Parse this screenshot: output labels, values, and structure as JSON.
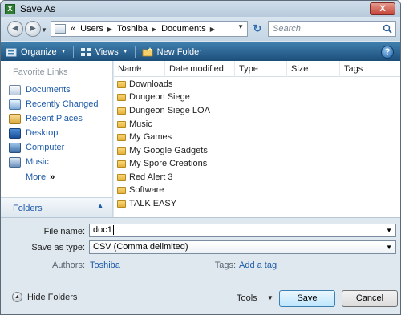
{
  "window": {
    "title": "Save As",
    "close_label": "X"
  },
  "address": {
    "crumbs": [
      "Users",
      "Toshiba",
      "Documents"
    ],
    "prefix": "«"
  },
  "search": {
    "placeholder": "Search"
  },
  "toolbar": {
    "organize": "Organize",
    "views": "Views",
    "new_folder": "New Folder",
    "help": "?"
  },
  "sidebar": {
    "heading": "Favorite Links",
    "items": [
      {
        "label": "Documents",
        "icon": "documents-icon"
      },
      {
        "label": "Recently Changed",
        "icon": "recently-changed-icon"
      },
      {
        "label": "Recent Places",
        "icon": "recent-places-icon"
      },
      {
        "label": "Desktop",
        "icon": "desktop-icon"
      },
      {
        "label": "Computer",
        "icon": "computer-icon"
      },
      {
        "label": "Music",
        "icon": "music-icon"
      }
    ],
    "more": "More",
    "folders": "Folders"
  },
  "columns": [
    "Name",
    "Date modified",
    "Type",
    "Size",
    "Tags"
  ],
  "files": [
    "Downloads",
    "Dungeon Siege",
    "Dungeon Siege LOA",
    "Music",
    "My Games",
    "My Google Gadgets",
    "My Spore Creations",
    "Red Alert 3",
    "Software",
    "TALK EASY"
  ],
  "form": {
    "file_name_label": "File name:",
    "file_name_value": "doc1",
    "save_type_label": "Save as type:",
    "save_type_value": "CSV (Comma delimited)",
    "authors_label": "Authors:",
    "authors_value": "Toshiba",
    "tags_label": "Tags:",
    "tags_value": "Add a tag"
  },
  "footer": {
    "hide_folders": "Hide Folders",
    "tools": "Tools",
    "save": "Save",
    "cancel": "Cancel"
  }
}
